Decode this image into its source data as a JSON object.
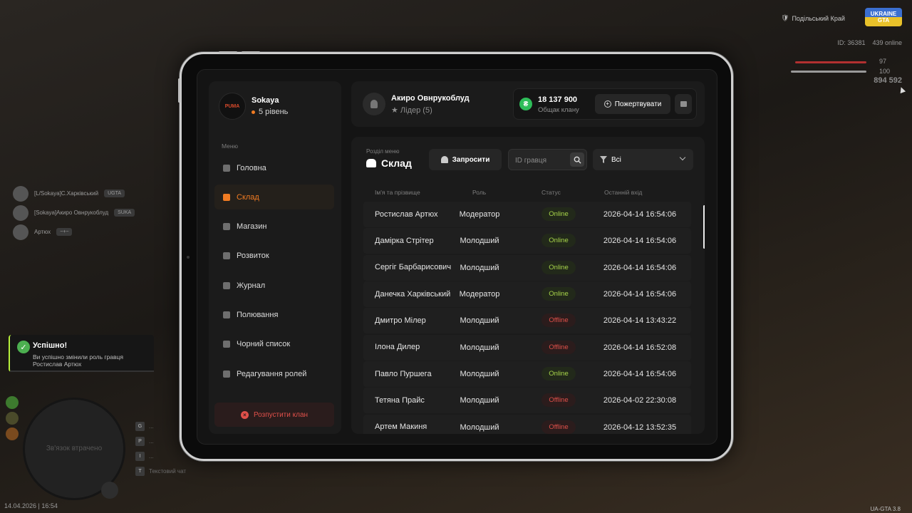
{
  "hud": {
    "server_name": "Подільський Край",
    "logo_text": "UKRAINE GTA",
    "player_id": "ID: 36381",
    "online": "439 online",
    "health": "97",
    "armor": "100",
    "money": "894 592",
    "clock": "14.04.2026 | 16:54",
    "version": "UA-GTA 3.8"
  },
  "chat": [
    {
      "text": "[L/Sokaya]С.Харківський",
      "badge": "UGTA"
    },
    {
      "text": "[Sokaya]Акиро Овнрукоблуд",
      "badge": "SUKA"
    },
    {
      "text": "Артюх",
      "badge": "~+~"
    }
  ],
  "toast": {
    "title": "Успішно!",
    "message": "Ви успішно змінили роль гравця Ростислав Артюх"
  },
  "radar": {
    "text": "Зв'язок втрачено"
  },
  "voice_hints": [
    {
      "key": "G",
      "label": "..."
    },
    {
      "key": "P",
      "label": "..."
    },
    {
      "key": "I",
      "label": "..."
    },
    {
      "key": "T",
      "label": "Текстовий чат"
    }
  ],
  "sidebar": {
    "clan_name": "Sokaya",
    "level": "5 рівень",
    "logo_text": "PUMA",
    "menu_caption": "Меню",
    "items": [
      {
        "label": "Головна"
      },
      {
        "label": "Склад"
      },
      {
        "label": "Магазин"
      },
      {
        "label": "Розвиток"
      },
      {
        "label": "Журнал"
      },
      {
        "label": "Полювання"
      },
      {
        "label": "Чорний список"
      },
      {
        "label": "Редагування ролей"
      }
    ],
    "disband_label": "Розпустити клан"
  },
  "topbar": {
    "user_name": "Акиро Овнрукоблуд",
    "user_role": "Лідер (5)",
    "bank_amount": "18 137 900",
    "bank_label": "Общак клану",
    "donate_label": "Пожертвувати"
  },
  "panel": {
    "caption": "Розділ меню",
    "title": "Склад",
    "invite_label": "Запросити",
    "search_placeholder": "ID гравця",
    "filter_value": "Всі",
    "columns": {
      "name": "Ім'я та прізвище",
      "role": "Роль",
      "status": "Статус",
      "last_login": "Останній вхід"
    },
    "members": [
      {
        "name": "Ростислав Артюх",
        "role": "Модератор",
        "status": "Online",
        "last": "2026-04-14 16:54:06"
      },
      {
        "name": "Дамірка Стрітер",
        "role": "Молодший",
        "status": "Online",
        "last": "2026-04-14 16:54:06"
      },
      {
        "name": "Сергіг Барбарисович",
        "role": "Молодший",
        "status": "Online",
        "last": "2026-04-14 16:54:06"
      },
      {
        "name": "Данечка Харківський",
        "role": "Модератор",
        "status": "Online",
        "last": "2026-04-14 16:54:06"
      },
      {
        "name": "Дмитро Мілер",
        "role": "Молодший",
        "status": "Offline",
        "last": "2026-04-14 13:43:22"
      },
      {
        "name": "Ілона Дилер",
        "role": "Молодший",
        "status": "Offline",
        "last": "2026-04-14 16:52:08"
      },
      {
        "name": "Павло Пуршега",
        "role": "Молодший",
        "status": "Online",
        "last": "2026-04-14 16:54:06"
      },
      {
        "name": "Тетяна Прайс",
        "role": "Молодший",
        "status": "Offline",
        "last": "2026-04-02 22:30:08"
      },
      {
        "name": "Артем Макиня",
        "role": "Молодший",
        "status": "Offline",
        "last": "2026-04-12 13:52:35"
      }
    ]
  },
  "colors": {
    "accent": "#f07b22",
    "online": "#a8d64a",
    "offline": "#e0504a",
    "bank_coin": "#2ebd59"
  }
}
